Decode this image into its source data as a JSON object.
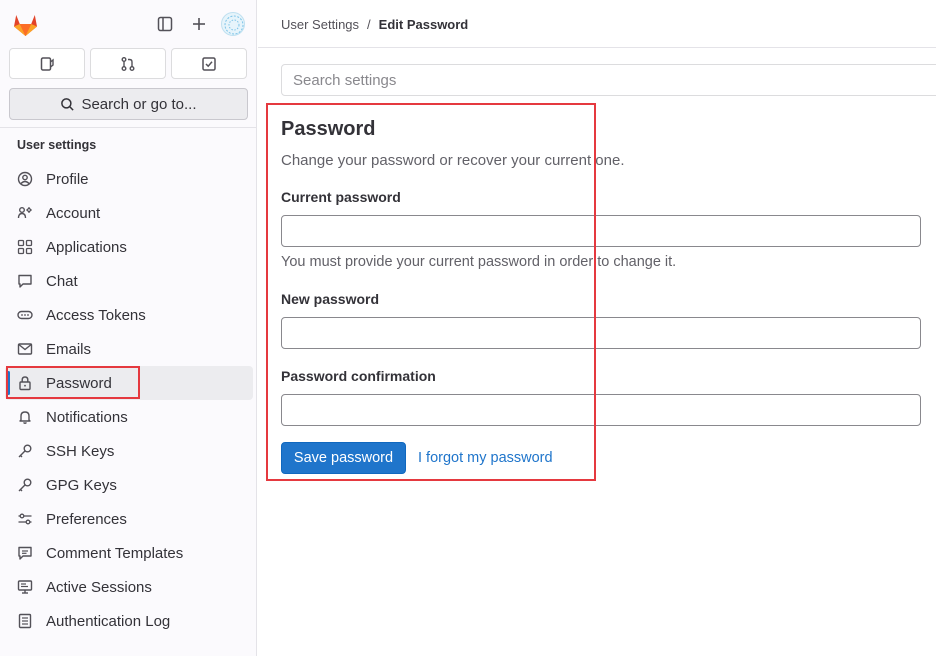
{
  "sidebar": {
    "section_title": "User settings",
    "search_label": "Search or go to...",
    "items": [
      {
        "label": "Profile",
        "icon": "profile-icon"
      },
      {
        "label": "Account",
        "icon": "account-icon"
      },
      {
        "label": "Applications",
        "icon": "applications-icon"
      },
      {
        "label": "Chat",
        "icon": "chat-icon"
      },
      {
        "label": "Access Tokens",
        "icon": "token-icon"
      },
      {
        "label": "Emails",
        "icon": "mail-icon"
      },
      {
        "label": "Password",
        "icon": "lock-icon",
        "active": true
      },
      {
        "label": "Notifications",
        "icon": "bell-icon"
      },
      {
        "label": "SSH Keys",
        "icon": "key-icon"
      },
      {
        "label": "GPG Keys",
        "icon": "key-icon"
      },
      {
        "label": "Preferences",
        "icon": "preferences-icon"
      },
      {
        "label": "Comment Templates",
        "icon": "comment-icon"
      },
      {
        "label": "Active Sessions",
        "icon": "monitor-icon"
      },
      {
        "label": "Authentication Log",
        "icon": "log-icon"
      }
    ]
  },
  "breadcrumb": {
    "parent": "User Settings",
    "separator": "/",
    "current": "Edit Password"
  },
  "search_settings": {
    "placeholder": "Search settings"
  },
  "form": {
    "title": "Password",
    "description": "Change your password or recover your current one.",
    "current_password_label": "Current password",
    "current_password_value": "",
    "current_password_help": "You must provide your current password in order to change it.",
    "new_password_label": "New password",
    "new_password_value": "",
    "confirm_label": "Password confirmation",
    "confirm_value": "",
    "save_label": "Save password",
    "forgot_label": "I forgot my password"
  },
  "colors": {
    "accent": "#1f75cb",
    "highlight": "#e5393f"
  }
}
